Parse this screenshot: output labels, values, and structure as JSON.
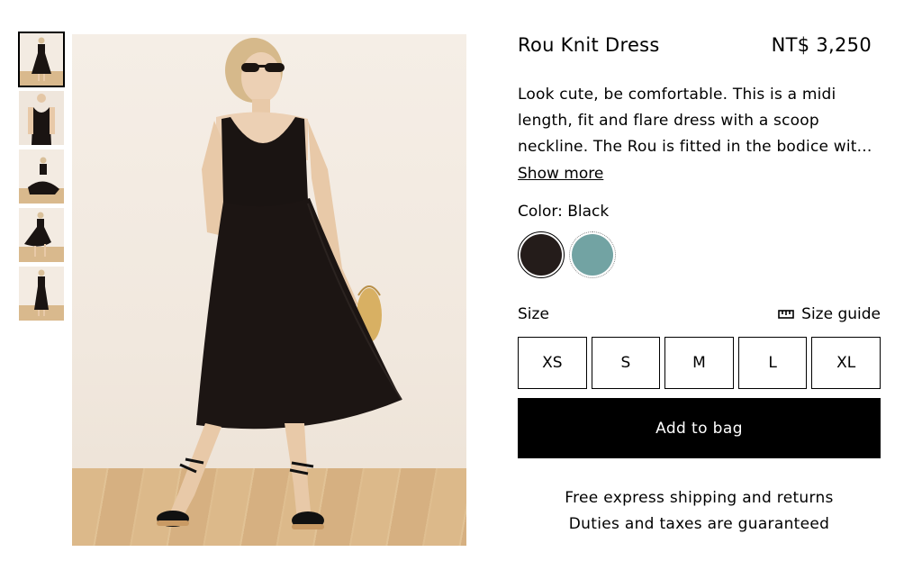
{
  "product": {
    "title": "Rou Knit Dress",
    "price": "NT$ 3,250",
    "description_lines": [
      "Look cute, be comfortable. This is a midi",
      "length, fit and flare dress with a scoop",
      "neckline. The Rou is fitted in the bodice wit..."
    ],
    "show_more_label": "Show more"
  },
  "gallery": {
    "thumbnail_count": 5,
    "selected_index": 0,
    "favorite_icon": "heart-outline-icon"
  },
  "color": {
    "label": "Color: Black",
    "swatches": [
      {
        "name": "Black",
        "hex": "#241c1a",
        "selected": true
      },
      {
        "name": "Teal",
        "hex": "#72a3a3",
        "selected": false
      }
    ]
  },
  "size": {
    "label": "Size",
    "guide_label": "Size guide",
    "guide_icon": "ruler-icon",
    "options": [
      "XS",
      "S",
      "M",
      "L",
      "XL"
    ]
  },
  "cta": {
    "add_to_bag_label": "Add to bag"
  },
  "notes": {
    "shipping": "Free express shipping and returns",
    "duties": "Duties and taxes are guaranteed"
  },
  "colors": {
    "button_bg": "#000000",
    "text": "#000000"
  }
}
